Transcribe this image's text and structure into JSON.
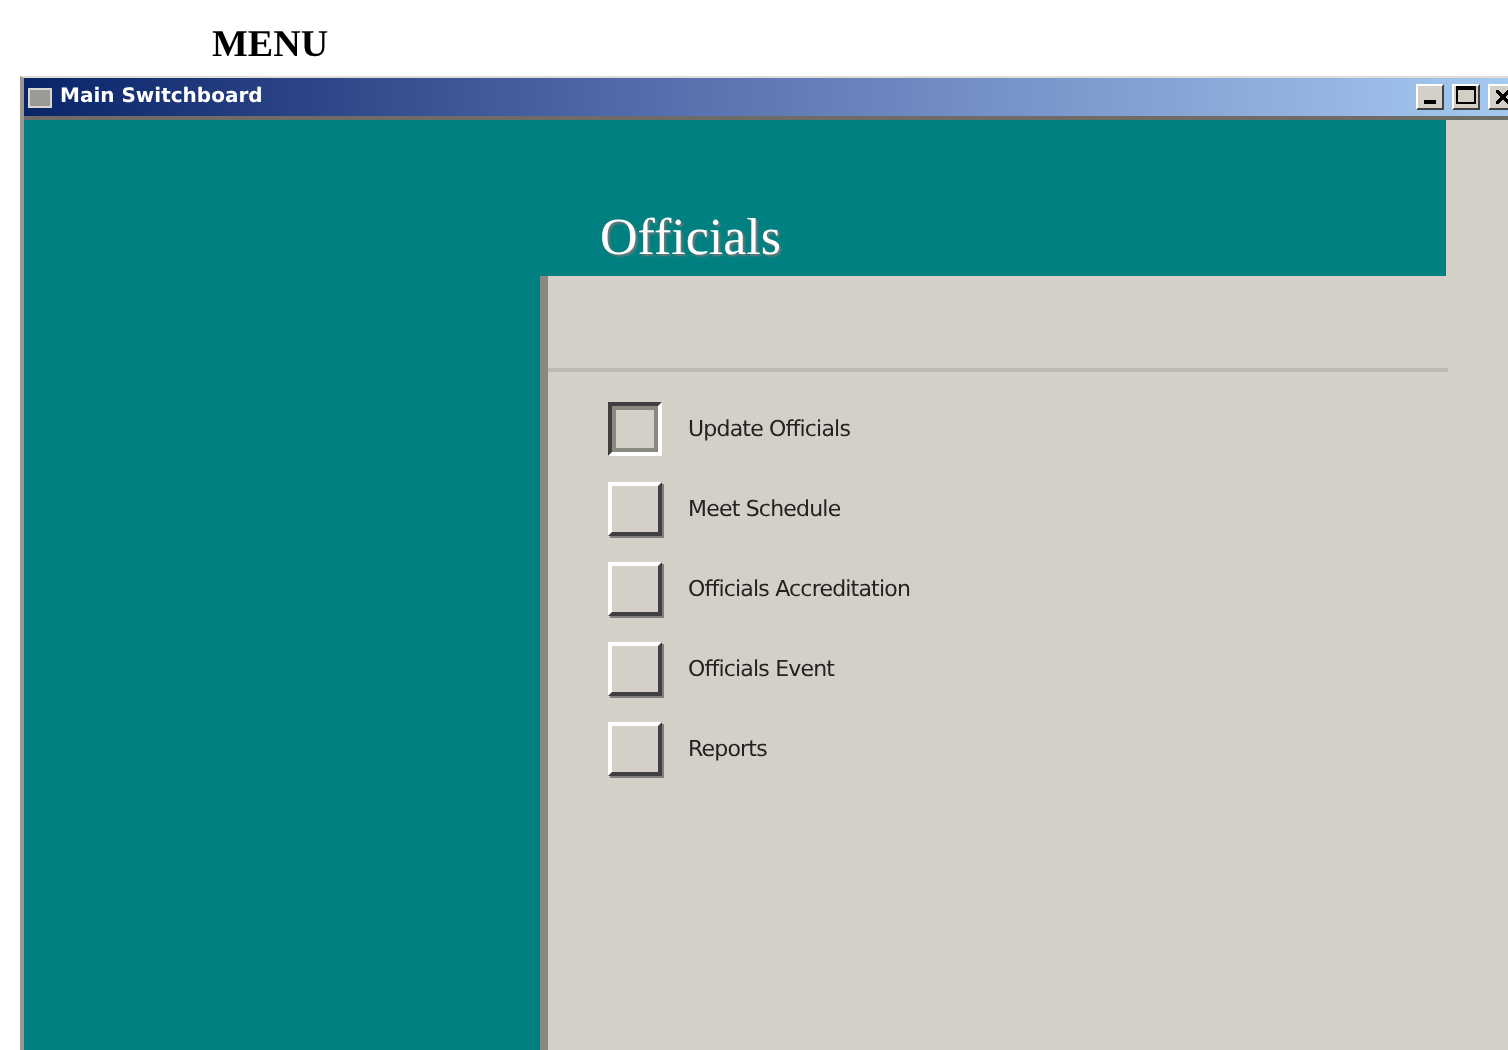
{
  "caption": "MENU",
  "window": {
    "title": "Main Switchboard"
  },
  "switchboard": {
    "heading": "Officials",
    "items": [
      {
        "label": "Update Officials",
        "selected": true
      },
      {
        "label": "Meet Schedule",
        "selected": false
      },
      {
        "label": "Officials Accreditation",
        "selected": false
      },
      {
        "label": "Officials Event",
        "selected": false
      },
      {
        "label": "Reports",
        "selected": false
      }
    ]
  }
}
